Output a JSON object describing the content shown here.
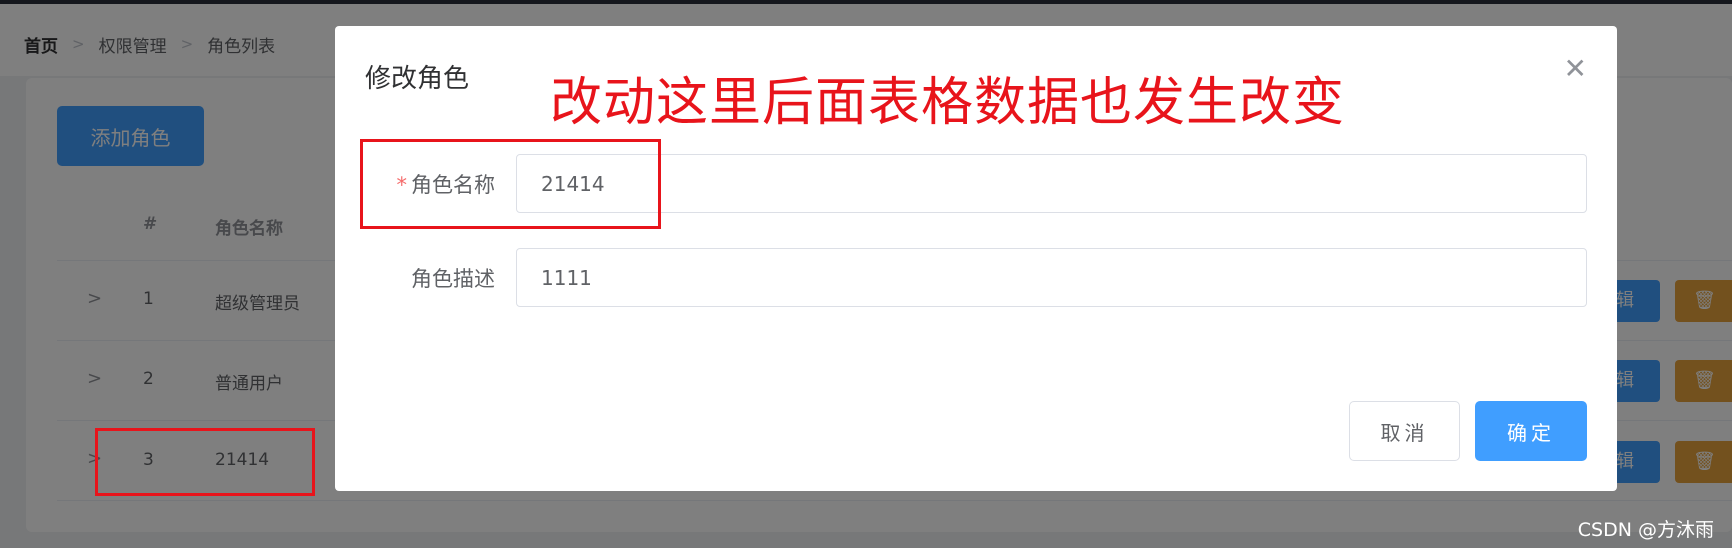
{
  "breadcrumb": [
    "首页",
    "权限管理",
    "角色列表"
  ],
  "page": {
    "add_button": "添加角色",
    "table": {
      "columns": [
        "#",
        "角色名称"
      ],
      "rows": [
        {
          "index": "1",
          "name": "超级管理员"
        },
        {
          "index": "2",
          "name": "普通用户"
        },
        {
          "index": "3",
          "name": "21414"
        }
      ],
      "edit_label": "辑",
      "delete_label": "删"
    }
  },
  "dialog": {
    "title": "修改角色",
    "annotation": "改动这里后面表格数据也发生改变",
    "required_mark": "*",
    "name_label": "角色名称",
    "name_value": "21414",
    "desc_label": "角色描述",
    "desc_value": "1111",
    "cancel_label": "取消",
    "confirm_label": "确定"
  },
  "watermark": "CSDN @方沐雨",
  "icons": {
    "separator": "chevron-right-icon",
    "expand": "chevron-right-icon",
    "close": "close-icon",
    "delete": "trash-icon"
  },
  "colors": {
    "primary": "#409eff",
    "warning": "#e6a23c",
    "annotation": "#e8141b"
  }
}
